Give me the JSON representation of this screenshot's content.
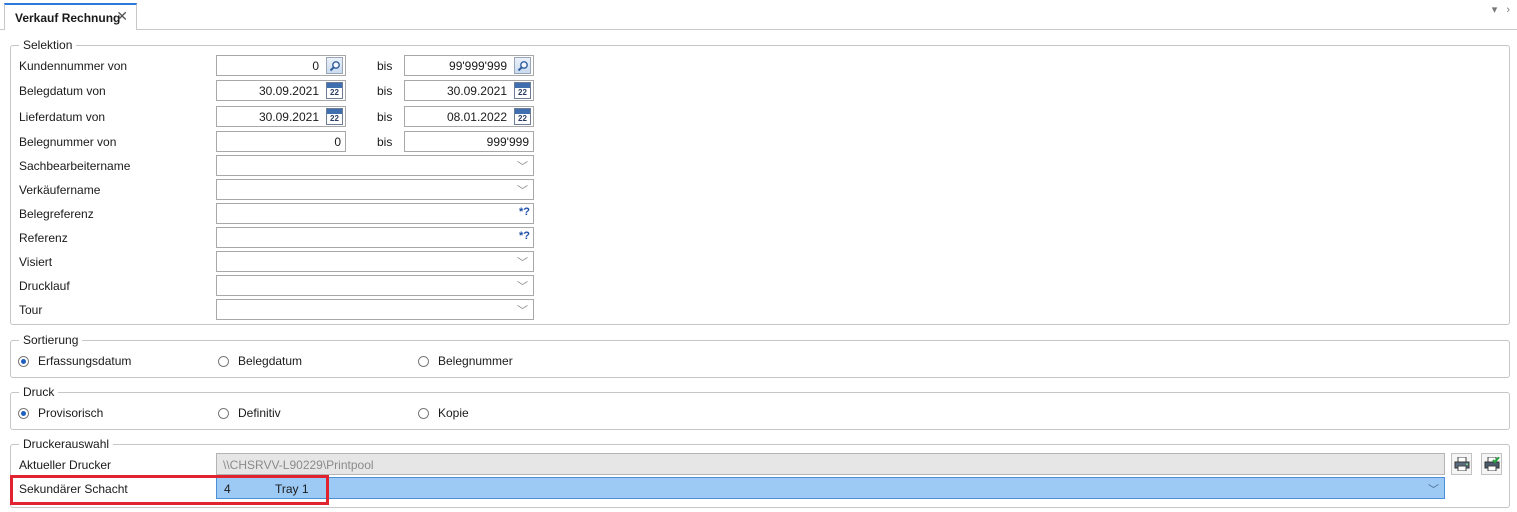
{
  "tab": {
    "title": "Verkauf Rechnung",
    "close": "✕"
  },
  "selektion": {
    "legend": "Selektion",
    "bis": "bis",
    "rows": [
      {
        "label": "Kundennummer von",
        "from": "0",
        "to": "99'999'999",
        "button": "search-icon"
      },
      {
        "label": "Belegdatum von",
        "from": "30.09.2021",
        "to": "30.09.2021",
        "button": "calendar-icon"
      },
      {
        "label": "Lieferdatum von",
        "from": "30.09.2021",
        "to": "08.01.2022",
        "button": "calendar-icon"
      },
      {
        "label": "Belegnummer von",
        "from": "0",
        "to": "999'999"
      }
    ],
    "calendar_day": "22",
    "single_fields": [
      {
        "label": "Sachbearbeitername",
        "kind": "dropdown"
      },
      {
        "label": "Verkäufername",
        "kind": "dropdown"
      },
      {
        "label": "Belegreferenz",
        "kind": "wildcard",
        "marker": "*?"
      },
      {
        "label": "Referenz",
        "kind": "wildcard",
        "marker": "*?"
      },
      {
        "label": "Visiert",
        "kind": "dropdown"
      },
      {
        "label": "Drucklauf",
        "kind": "dropdown"
      },
      {
        "label": "Tour",
        "kind": "dropdown"
      }
    ]
  },
  "sortierung": {
    "legend": "Sortierung",
    "options": [
      {
        "label": "Erfassungsdatum",
        "selected": true
      },
      {
        "label": "Belegdatum",
        "selected": false
      },
      {
        "label": "Belegnummer",
        "selected": false
      }
    ]
  },
  "druck": {
    "legend": "Druck",
    "options": [
      {
        "label": "Provisorisch",
        "selected": true
      },
      {
        "label": "Definitiv",
        "selected": false
      },
      {
        "label": "Kopie",
        "selected": false
      }
    ]
  },
  "druckerauswahl": {
    "legend": "Druckerauswahl",
    "printer_label": "Aktueller Drucker",
    "printer_value": "\\\\CHSRVV-L90229\\Printpool",
    "tray_label": "Sekundärer Schacht",
    "tray_number": "4",
    "tray_name": "Tray 1"
  },
  "colors": {
    "accent": "#2b79d8",
    "highlight": "#9dcaf5",
    "annotation": "#e0232e"
  }
}
